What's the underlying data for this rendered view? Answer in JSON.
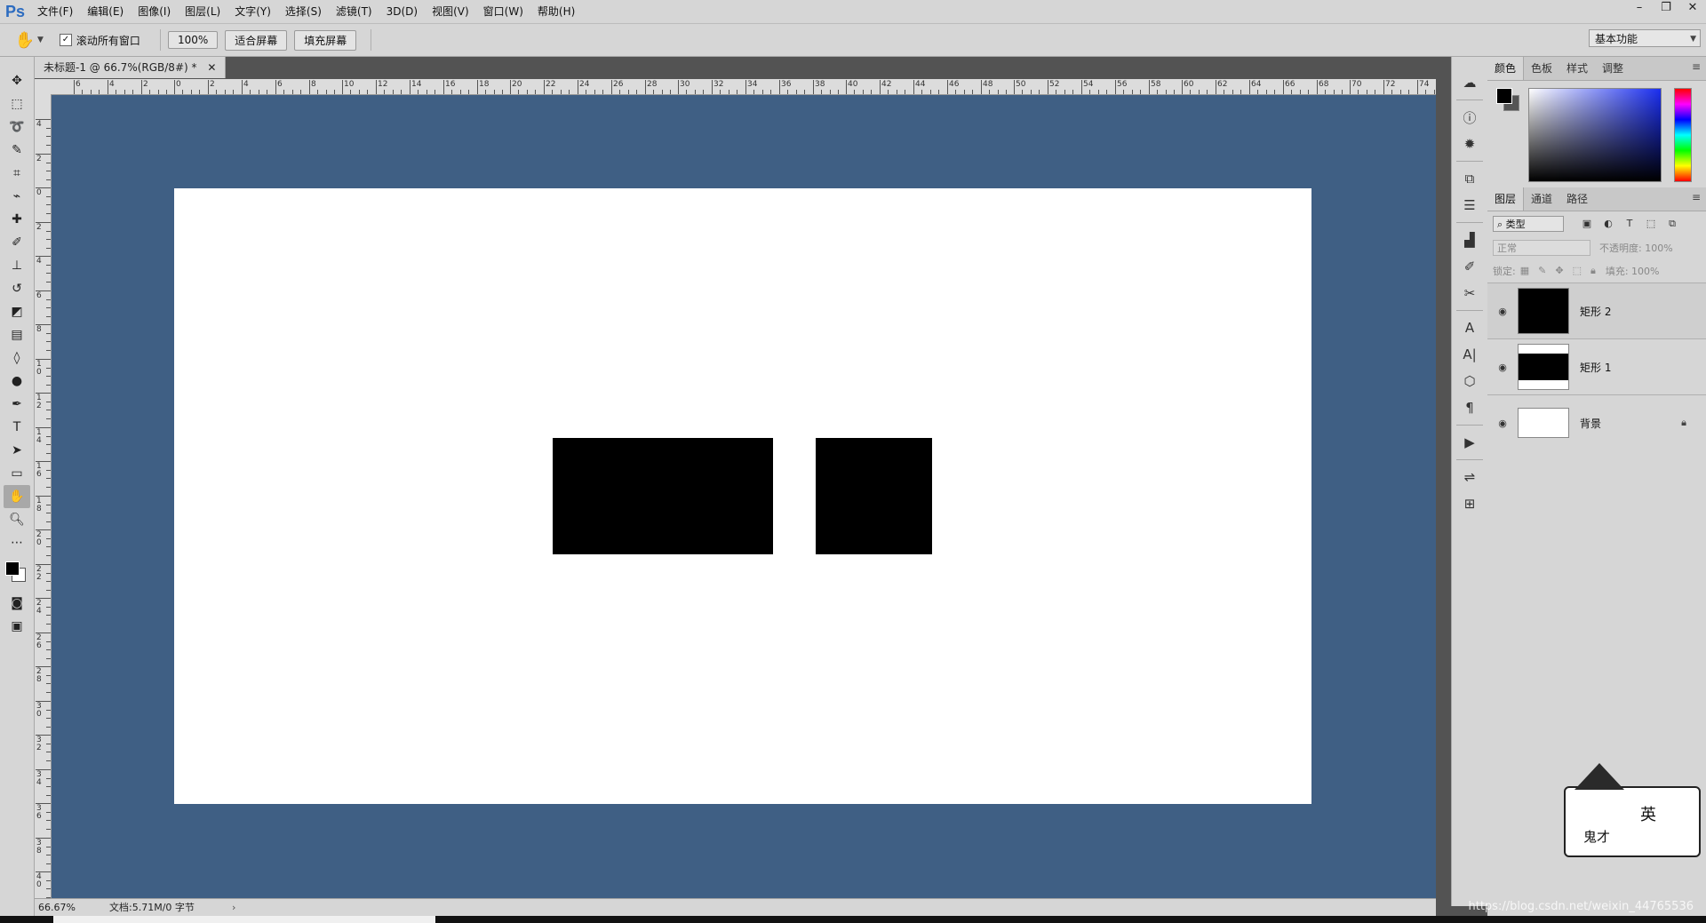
{
  "app": {
    "logo": "Ps"
  },
  "menu": [
    "文件(F)",
    "编辑(E)",
    "图像(I)",
    "图层(L)",
    "文字(Y)",
    "选择(S)",
    "滤镜(T)",
    "3D(D)",
    "视图(V)",
    "窗口(W)",
    "帮助(H)"
  ],
  "options": {
    "scroll_all_label": "滚动所有窗口",
    "zoom_value": "100%",
    "fit_screen": "适合屏幕",
    "fill_screen": "填充屏幕",
    "workspace": "基本功能"
  },
  "document": {
    "tab_title": "未标题-1 @ 66.7%(RGB/8#) *",
    "zoom": "66.67%",
    "doc_info": "文档:5.71M/0 字节",
    "canvas_color": "#ffffff",
    "pasteboard_color": "#3f5f84"
  },
  "ruler": {
    "h_labels": [
      "6",
      "4",
      "2",
      "0",
      "2",
      "4",
      "6",
      "8",
      "10",
      "12",
      "14",
      "16",
      "18",
      "20",
      "22",
      "24",
      "26",
      "28",
      "30",
      "32",
      "34",
      "36",
      "38",
      "40",
      "42",
      "44",
      "46",
      "48",
      "50",
      "52",
      "54",
      "56",
      "58",
      "60",
      "62",
      "64",
      "66",
      "68",
      "70",
      "72",
      "74"
    ],
    "v_labels": [
      "4",
      "2",
      "0",
      "2",
      "4",
      "6",
      "8",
      "10",
      "12",
      "14",
      "16",
      "18",
      "20",
      "22",
      "24",
      "26",
      "28",
      "30",
      "32",
      "34",
      "36",
      "38",
      "40"
    ]
  },
  "color_panel": {
    "tabs": [
      "颜色",
      "色板",
      "样式",
      "调整"
    ]
  },
  "layers_panel": {
    "tabs": [
      "图层",
      "通道",
      "路径"
    ],
    "kind_filter": "类型",
    "blend_mode": "正常",
    "opacity_label": "不透明度: 100%",
    "lock_label": "锁定:",
    "fill_label": "填充: 100%",
    "layers": [
      {
        "name": "矩形 2"
      },
      {
        "name": "矩形 1"
      },
      {
        "name": "背景"
      }
    ]
  },
  "mascot": {
    "line1": "鬼才",
    "line2": "英"
  },
  "watermark": "https://blog.csdn.net/weixin_44765536"
}
